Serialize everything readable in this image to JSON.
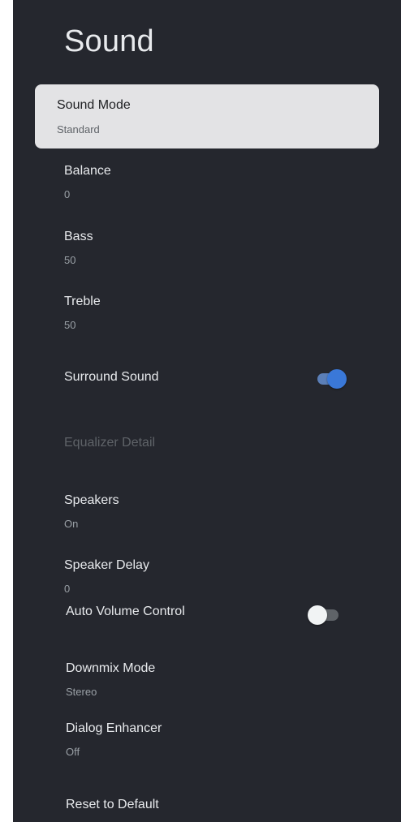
{
  "header": {
    "title": "Sound"
  },
  "items": [
    {
      "label": "Sound Mode",
      "value": "Standard"
    },
    {
      "label": "Balance",
      "value": "0"
    },
    {
      "label": "Bass",
      "value": "50"
    },
    {
      "label": "Treble",
      "value": "50"
    },
    {
      "label": "Surround Sound",
      "toggle": "on"
    },
    {
      "label": "Equalizer Detail",
      "state": "disabled"
    },
    {
      "label": "Speakers",
      "value": "On"
    },
    {
      "label": "Speaker Delay",
      "value": "0"
    },
    {
      "label": "Auto Volume Control",
      "toggle": "off"
    },
    {
      "label": "Downmix Mode",
      "value": "Stereo"
    },
    {
      "label": "Dialog Enhancer",
      "value": "Off"
    },
    {
      "label": "Reset to Default"
    }
  ],
  "colors": {
    "background": "#25272e",
    "selected_background": "#e3e3e5",
    "toggle_on": "#3a78d8",
    "toggle_off_thumb": "#f1f3f4"
  }
}
